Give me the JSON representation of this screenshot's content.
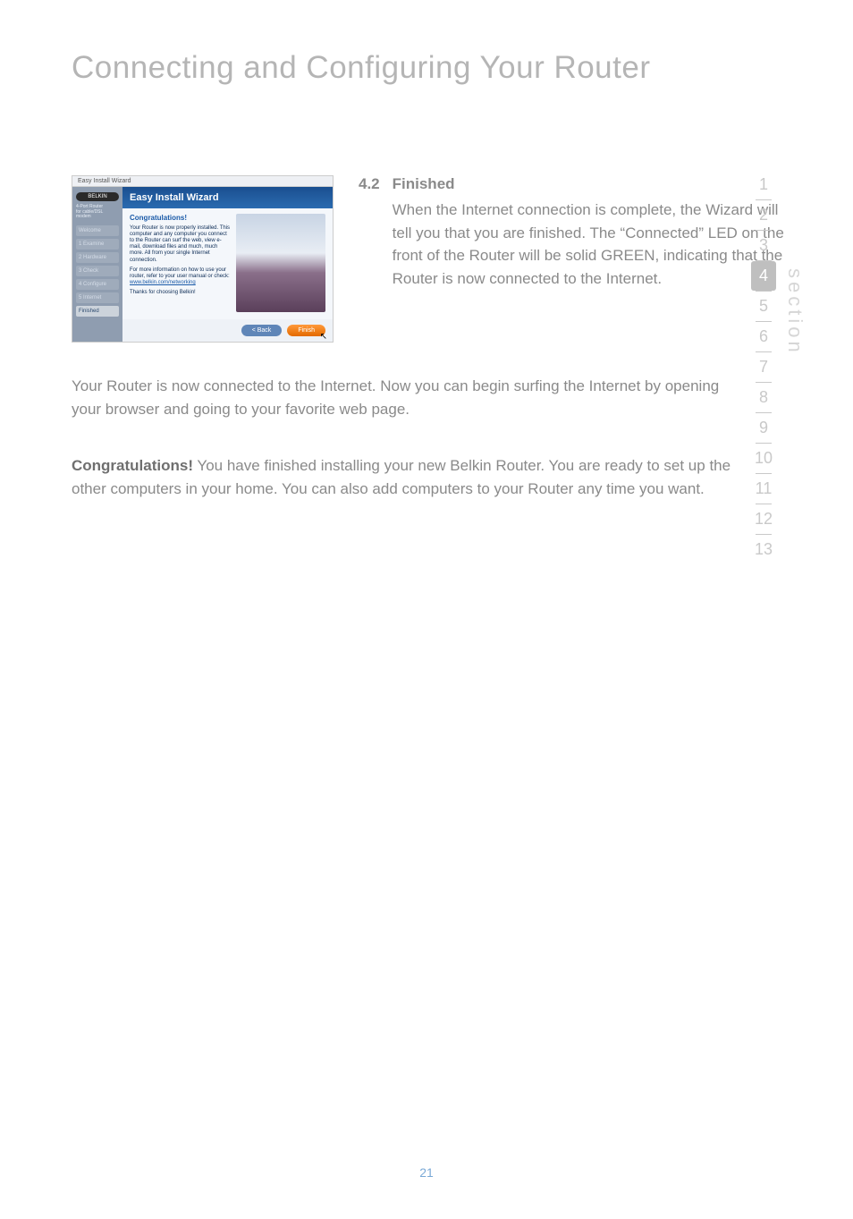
{
  "page_title": "Connecting and Configuring Your Router",
  "page_number": "21",
  "section_label": "section",
  "nav_numbers": [
    "1",
    "2",
    "3",
    "4",
    "5",
    "6",
    "7",
    "8",
    "9",
    "10",
    "11",
    "12",
    "13"
  ],
  "nav_selected_index": 3,
  "step": {
    "number": "4.2",
    "title": "Finished",
    "text": "When the Internet connection is complete, the Wizard will tell you that you are finished. The “Connected” LED on the front of the Router will be solid GREEN, indicating that the Router is now connected to the Internet."
  },
  "para1": "Your Router is now connected to the Internet. Now you can begin surfing the Internet by opening your browser and going to your favorite web page.",
  "para2_strong": "Congratulations!",
  "para2_rest": " You have finished installing your new Belkin Router. You are ready to set up the other computers in your home. You can also add computers to your Router any time you want.",
  "screenshot": {
    "window_title": "Easy Install Wizard",
    "logo": "BELKIN",
    "product_line1": "4-Port Router",
    "product_line2": "for cable/DSL modem",
    "steps": [
      "Welcome",
      "1 Examine",
      "2 Hardware",
      "3 Check",
      "4 Configure",
      "5 Internet",
      "Finished"
    ],
    "active_step_index": 6,
    "banner": "Easy Install Wizard",
    "congrats_heading": "Congratulations!",
    "congrats_p1": "Your Router is now properly installed. This computer and any computer you connect to the Router can surf the web, view e-mail, download files and much, much more. All from your single Internet connection.",
    "congrats_p2a": "For more information on how to use your router, refer to your user manual or check: ",
    "congrats_link": "www.belkin.com/networking",
    "congrats_p3": "Thanks for choosing Belkin!",
    "btn_back": "< Back",
    "btn_finish": "Finish"
  }
}
